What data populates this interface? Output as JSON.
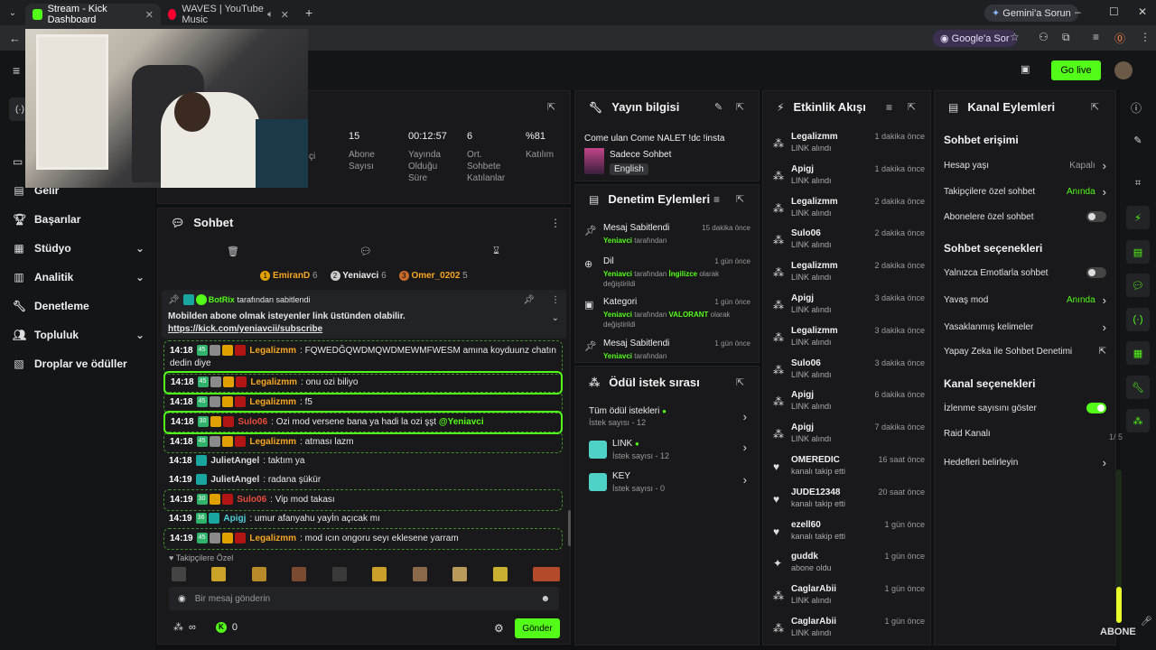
{
  "browser": {
    "tabs": [
      {
        "title": "Stream - Kick Dashboard",
        "active": true,
        "color": "#53fc18"
      },
      {
        "title": "WAVES | YouTube Music",
        "active": false,
        "color": "#ff0033"
      }
    ],
    "gemini_btn": "Gemini'a Sorun",
    "google_btn": "Google'a Sor"
  },
  "header": {
    "golive": "Go live"
  },
  "sidebar": {
    "items": [
      {
        "label": "Gelir",
        "icon": "wallet-icon"
      },
      {
        "label": "Başarılar",
        "icon": "trophy-icon"
      },
      {
        "label": "Stüdyo",
        "icon": "studio-icon",
        "chev": true
      },
      {
        "label": "Analitik",
        "icon": "chart-icon",
        "chev": true
      },
      {
        "label": "Denetleme",
        "icon": "wrench-icon"
      },
      {
        "label": "Topluluk",
        "icon": "people-icon",
        "chev": true
      },
      {
        "label": "Droplar ve ödüller",
        "icon": "gift-icon"
      }
    ]
  },
  "stats": [
    {
      "value": "15",
      "label": "Abone Sayısı"
    },
    {
      "value": "00:12:57",
      "label": "Yayında Olduğu Süre"
    },
    {
      "value": "6",
      "label": "Ort. Sohbete Katılanlar"
    },
    {
      "value": "%81",
      "label": "Katılım"
    }
  ],
  "stats_partial": "çi",
  "chat": {
    "title": "Sohbet",
    "top_users": [
      {
        "rank": "1",
        "name": "EmiranD",
        "count": "6"
      },
      {
        "rank": "2",
        "name": "Yeniavci",
        "count": "6"
      },
      {
        "rank": "3",
        "name": "Omer_0202",
        "count": "5"
      }
    ],
    "pinned": {
      "by": "BotRix",
      "by_text": "tarafından sabitlendi",
      "text": "Mobilden abone olmak isteyenler link üstünden olabilir.",
      "link": "https://kick.com/yeniavcii/subscribe"
    },
    "messages": [
      {
        "time": "14:18",
        "sub": "45",
        "user": "Legalizmm",
        "ucolor": "orange",
        "text": "FQWEDĞQWDMQWDMEWMFWESM amına koyduunz chatın dedin diye",
        "hl": "hl2"
      },
      {
        "time": "14:18",
        "sub": "45",
        "user": "Legalizmm",
        "ucolor": "orange",
        "text": "onu ozi biliyo",
        "hl": "hl3"
      },
      {
        "time": "14:18",
        "sub": "45",
        "user": "Legalizmm",
        "ucolor": "orange",
        "text": "f5",
        "hl": "hl2"
      },
      {
        "time": "14:18",
        "sub": "30",
        "user": "Sulo06",
        "ucolor": "red",
        "text": "Ozi mod versene bana ya hadi la ozi şşt",
        "mention": "@Yeniavci",
        "hl": "hl3"
      },
      {
        "time": "14:18",
        "sub": "45",
        "user": "Legalizmm",
        "ucolor": "orange",
        "text": "atması lazm",
        "hl": "hl2"
      },
      {
        "time": "14:18",
        "sub": "",
        "user": "JulietAngel",
        "ucolor": "white",
        "text": "taktım ya",
        "hl": ""
      },
      {
        "time": "14:19",
        "sub": "",
        "user": "JulietAngel",
        "ucolor": "white",
        "text": "radana şükür",
        "hl": ""
      },
      {
        "time": "14:19",
        "sub": "30",
        "user": "Sulo06",
        "ucolor": "red",
        "text": "Vip mod takası",
        "hl": "hl2"
      },
      {
        "time": "14:19",
        "sub": "36",
        "user": "Apigj",
        "ucolor": "teal",
        "text": "umur afanyahu yayİn açıcak mı",
        "hl": ""
      },
      {
        "time": "14:19",
        "sub": "45",
        "user": "Legalizmm",
        "ucolor": "orange",
        "text": "mod ıcın ongoru seyı eklesene yarram",
        "hl": "hl2"
      }
    ],
    "followers_label": "Takipçilere Özel",
    "input_placeholder": "Bir mesaj gönderin",
    "infinity": "∞",
    "points": "0",
    "send": "Gönder"
  },
  "stream_info": {
    "title": "Yayın bilgisi",
    "stream_title": "Come ulan Come NALET !dc !insta",
    "category": "Sadece Sohbet",
    "language": "English"
  },
  "mod_actions": {
    "title": "Denetim Eylemleri",
    "items": [
      {
        "title": "Mesaj Sabitlendi",
        "time": "15 dakika önce",
        "actor": "Yeniavci",
        "rest": "tarafından",
        "extra": ""
      },
      {
        "title": "Dil",
        "time": "1 gün önce",
        "actor": "Yeniavci",
        "rest": "tarafından",
        "extra": "İngilizce",
        "rest2": "olarak değiştirildi"
      },
      {
        "title": "Kategori",
        "time": "1 gün önce",
        "actor": "Yeniavci",
        "rest": "tarafından",
        "extra": "VALORANT",
        "rest2": "olarak değiştirildi"
      },
      {
        "title": "Mesaj Sabitlendi",
        "time": "1 gün önce",
        "actor": "Yeniavci",
        "rest": "tarafından",
        "extra": ""
      }
    ]
  },
  "rewards": {
    "title": "Ödül istek sırası",
    "all": "Tüm ödül istekleri",
    "all_count": "İstek sayısı - 12",
    "items": [
      {
        "name": "LINK",
        "count": "İstek sayısı - 12"
      },
      {
        "name": "KEY",
        "count": "İstek sayısı - 0"
      }
    ]
  },
  "events": {
    "title": "Etkinlik Akışı",
    "items": [
      {
        "name": "Legalizmm",
        "sub": "LINK alındı",
        "time": "1 dakika önce",
        "type": "reward"
      },
      {
        "name": "Apigj",
        "sub": "LINK alındı",
        "time": "1 dakika önce",
        "type": "reward"
      },
      {
        "name": "Legalizmm",
        "sub": "LINK alındı",
        "time": "2 dakika önce",
        "type": "reward"
      },
      {
        "name": "Sulo06",
        "sub": "LINK alındı",
        "time": "2 dakika önce",
        "type": "reward"
      },
      {
        "name": "Legalizmm",
        "sub": "LINK alındı",
        "time": "2 dakika önce",
        "type": "reward"
      },
      {
        "name": "Apigj",
        "sub": "LINK alındı",
        "time": "3 dakika önce",
        "type": "reward"
      },
      {
        "name": "Legalizmm",
        "sub": "LINK alındı",
        "time": "3 dakika önce",
        "type": "reward"
      },
      {
        "name": "Sulo06",
        "sub": "LINK alındı",
        "time": "3 dakika önce",
        "type": "reward"
      },
      {
        "name": "Apigj",
        "sub": "LINK alındı",
        "time": "6 dakika önce",
        "type": "reward"
      },
      {
        "name": "Apigj",
        "sub": "LINK alındı",
        "time": "7 dakika önce",
        "type": "reward"
      },
      {
        "name": "OMEREDIC",
        "sub": "kanalı takip etti",
        "time": "16 saat önce",
        "type": "follow"
      },
      {
        "name": "JUDE12348",
        "sub": "kanalı takip etti",
        "time": "20 saat önce",
        "type": "follow"
      },
      {
        "name": "ezell60",
        "sub": "kanalı takip etti",
        "time": "1 gün önce",
        "type": "follow"
      },
      {
        "name": "guddk",
        "sub": "abone oldu",
        "time": "1 gün önce",
        "type": "sub"
      },
      {
        "name": "CaglarAbii",
        "sub": "LINK alındı",
        "time": "1 gün önce",
        "type": "reward"
      },
      {
        "name": "CaglarAbii",
        "sub": "LINK alındı",
        "time": "1 gün önce",
        "type": "reward"
      }
    ]
  },
  "channel_actions": {
    "title": "Kanal Eylemleri",
    "chat_access": "Sohbet erişimi",
    "rows1": [
      {
        "label": "Hesap yaşı",
        "value": "Kapalı",
        "kind": "link-muted"
      },
      {
        "label": "Takipçilere özel sohbet",
        "value": "Anında",
        "kind": "link-green"
      },
      {
        "label": "Abonelere özel sohbet",
        "value": "",
        "kind": "toggle-off"
      }
    ],
    "chat_options": "Sohbet seçenekleri",
    "rows2": [
      {
        "label": "Yalnızca Emotlarla sohbet",
        "value": "",
        "kind": "toggle-off"
      },
      {
        "label": "Yavaş mod",
        "value": "Anında",
        "kind": "link-green"
      },
      {
        "label": "Yasaklanmış kelimeler",
        "value": "",
        "kind": "link"
      },
      {
        "label": "Yapay Zeka ile Sohbet Denetimi",
        "value": "",
        "kind": "external"
      }
    ],
    "channel_options": "Kanal seçenekleri",
    "rows3": [
      {
        "label": "İzlenme sayısını göster",
        "value": "",
        "kind": "toggle-on"
      },
      {
        "label": "Raid Kanalı",
        "value": "",
        "kind": "none"
      },
      {
        "label": "Hedefleri belirleyin",
        "value": "",
        "kind": "link"
      }
    ]
  },
  "overlay": {
    "abone": "ABONE",
    "frac": "1/ 5"
  }
}
